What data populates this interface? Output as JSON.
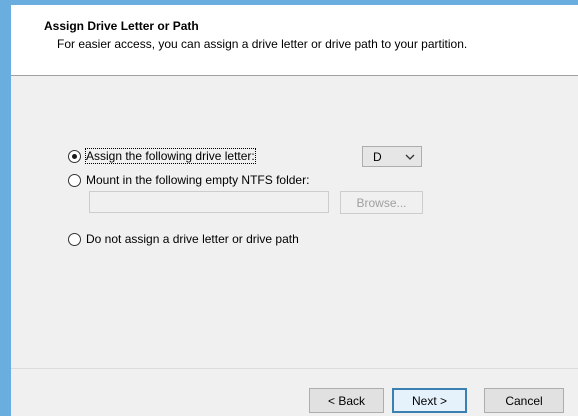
{
  "header": {
    "title": "Assign Drive Letter or Path",
    "subtitle": "For easier access, you can assign a drive letter or drive path to your partition."
  },
  "options": {
    "assign_letter": {
      "label": "Assign the following drive letter:",
      "selected": true
    },
    "mount_folder": {
      "label": "Mount in the following empty NTFS folder:",
      "selected": false
    },
    "no_letter": {
      "label": "Do not assign a drive letter or drive path",
      "selected": false
    }
  },
  "drive_letter": {
    "value": "D"
  },
  "folder_path": {
    "value": "",
    "placeholder": ""
  },
  "browse_button": {
    "label": "Browse..."
  },
  "footer": {
    "back_label": "< Back",
    "next_label": "Next >",
    "cancel_label": "Cancel"
  },
  "colors": {
    "frame_accent": "#6aaee0",
    "default_button_border": "#3c7fb1"
  }
}
